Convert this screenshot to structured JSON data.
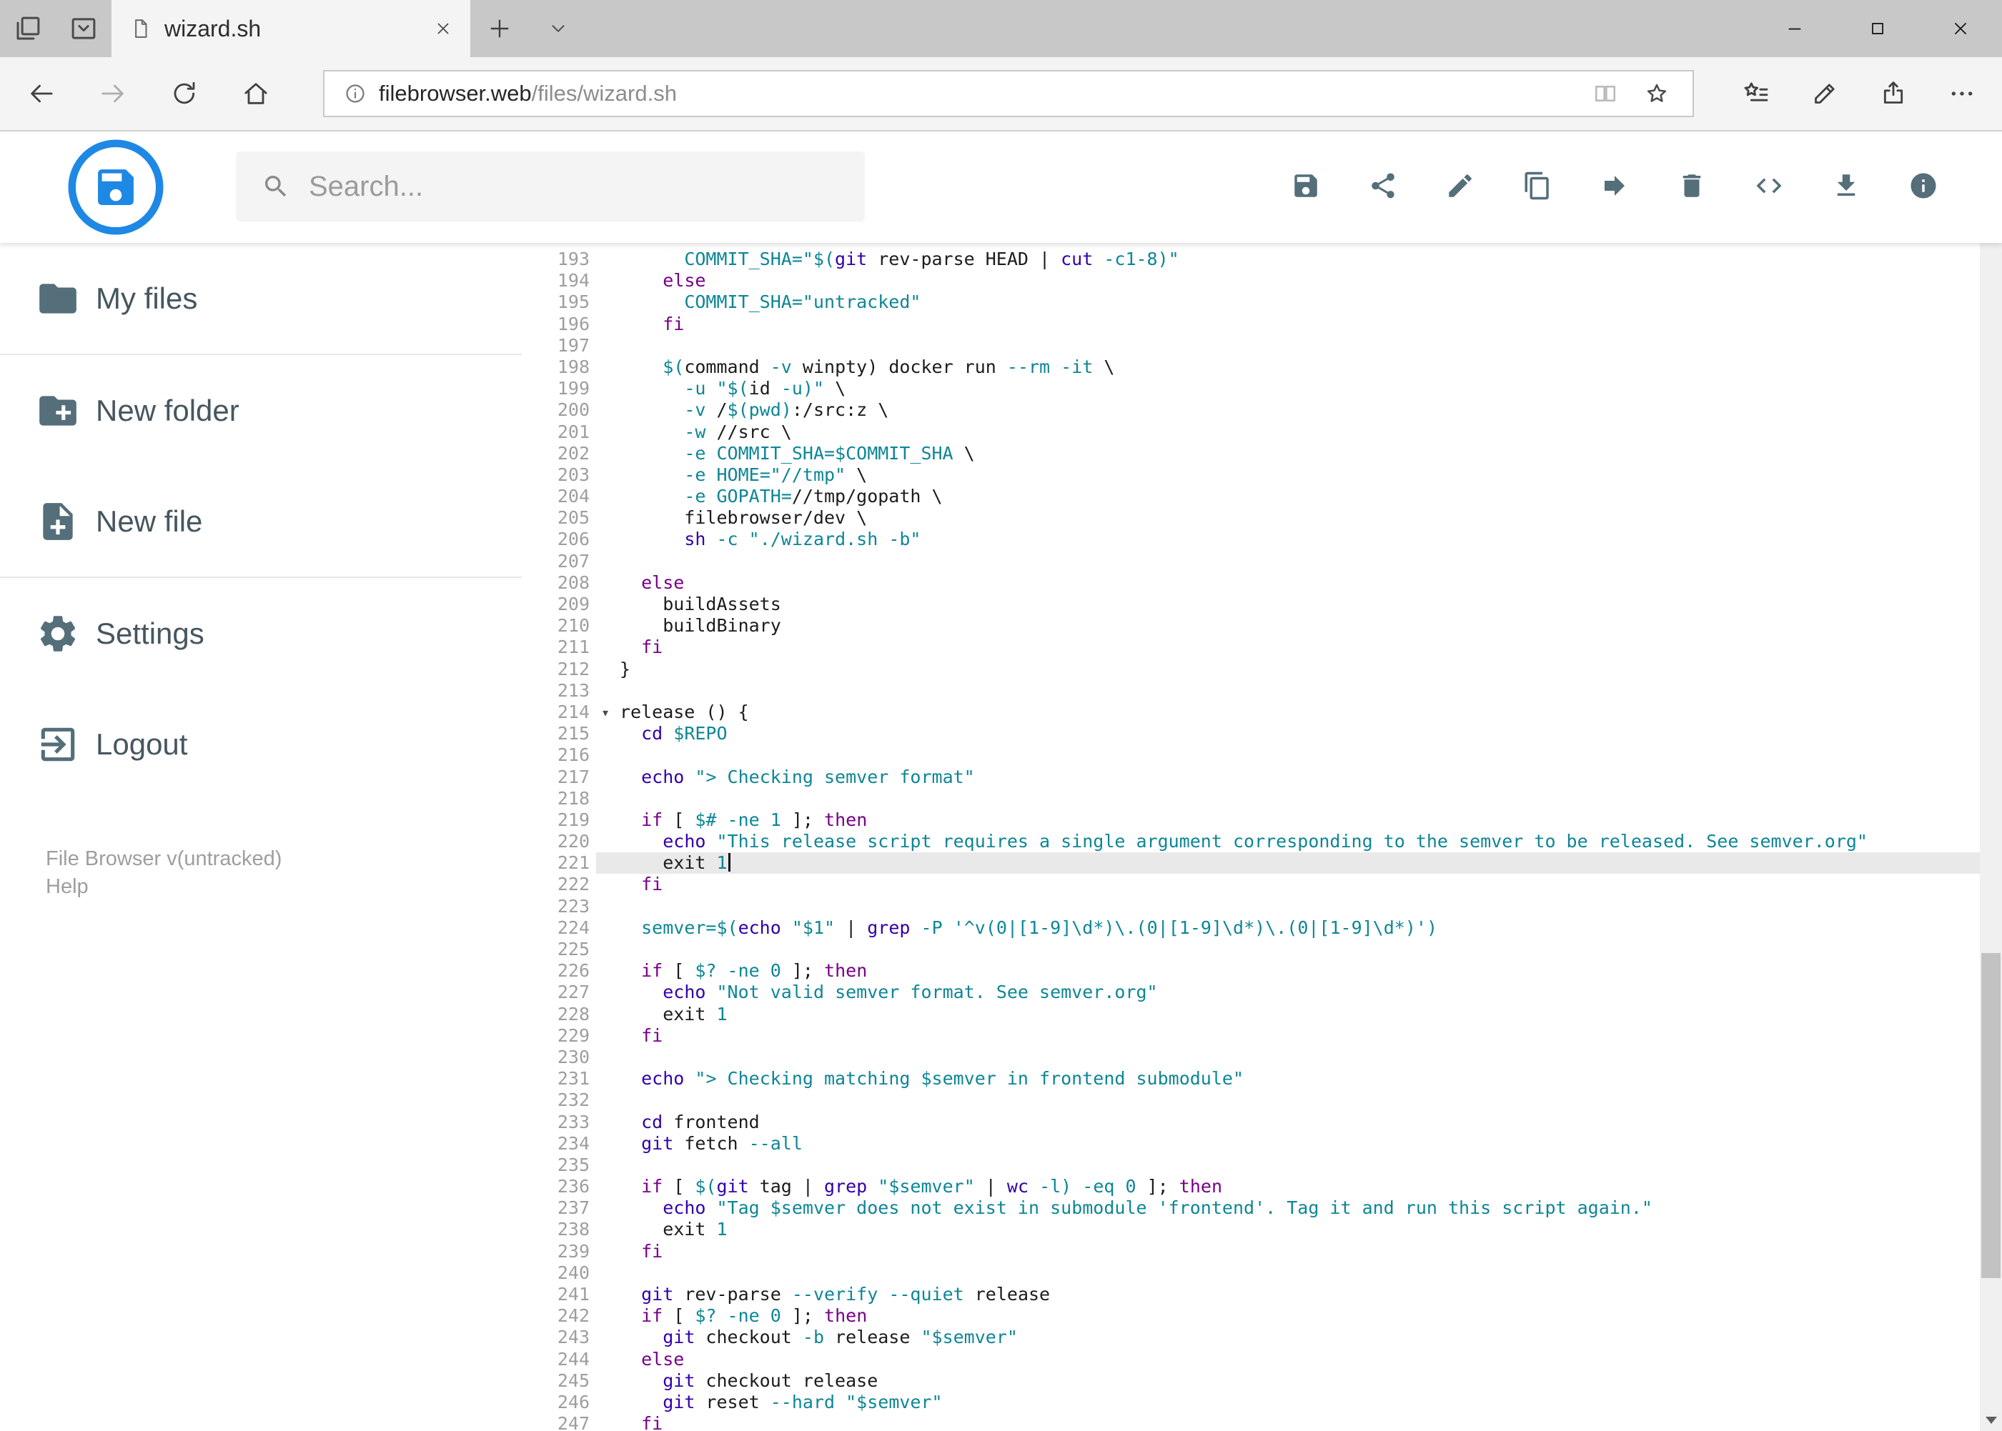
{
  "browser": {
    "tab_title": "wizard.sh",
    "url_domain": "filebrowser.web",
    "url_path": "/files/wizard.sh"
  },
  "header": {
    "search_placeholder": "Search...",
    "actions": [
      {
        "id": "save",
        "icon": "save"
      },
      {
        "id": "share",
        "icon": "share"
      },
      {
        "id": "edit",
        "icon": "edit"
      },
      {
        "id": "copy",
        "icon": "copy"
      },
      {
        "id": "move",
        "icon": "move"
      },
      {
        "id": "delete",
        "icon": "delete"
      },
      {
        "id": "raw-code",
        "icon": "code"
      },
      {
        "id": "download",
        "icon": "download"
      },
      {
        "id": "info",
        "icon": "info"
      }
    ]
  },
  "sidebar": {
    "items": [
      {
        "id": "my-files",
        "label": "My files",
        "icon": "folder",
        "divider_after": true
      },
      {
        "id": "new-folder",
        "label": "New folder",
        "icon": "folder-plus"
      },
      {
        "id": "new-file",
        "label": "New file",
        "icon": "file-plus",
        "divider_after": true
      },
      {
        "id": "settings",
        "label": "Settings",
        "icon": "gear"
      },
      {
        "id": "logout",
        "label": "Logout",
        "icon": "logout"
      }
    ],
    "footer_version": "File Browser v(untracked)",
    "footer_help": "Help"
  },
  "editor": {
    "active_line": 221,
    "cursor_line": 221,
    "fold_lines": [
      214
    ],
    "lines": [
      {
        "n": 193,
        "s": [
          [
            "d",
            "      "
          ],
          [
            "t",
            "COMMIT_SHA=\"$("
          ],
          [
            "b",
            "git"
          ],
          [
            "d",
            " rev-parse HEAD | "
          ],
          [
            "b",
            "cut"
          ],
          [
            "d",
            " "
          ],
          [
            "t",
            "-c1-8)\""
          ]
        ]
      },
      {
        "n": 194,
        "s": [
          [
            "d",
            "    "
          ],
          [
            "k",
            "else"
          ]
        ]
      },
      {
        "n": 195,
        "s": [
          [
            "d",
            "      "
          ],
          [
            "t",
            "COMMIT_SHA=\"untracked\""
          ]
        ]
      },
      {
        "n": 196,
        "s": [
          [
            "d",
            "    "
          ],
          [
            "k",
            "fi"
          ]
        ]
      },
      {
        "n": 197,
        "s": []
      },
      {
        "n": 198,
        "s": [
          [
            "d",
            "    "
          ],
          [
            "t",
            "$("
          ],
          [
            "d",
            "command "
          ],
          [
            "t",
            "-v"
          ],
          [
            "d",
            " winpty) docker run "
          ],
          [
            "t",
            "--rm"
          ],
          [
            "d",
            " "
          ],
          [
            "t",
            "-it"
          ],
          [
            "d",
            " \\"
          ]
        ]
      },
      {
        "n": 199,
        "s": [
          [
            "d",
            "      "
          ],
          [
            "t",
            "-u"
          ],
          [
            "d",
            " "
          ],
          [
            "t",
            "\"$("
          ],
          [
            "d",
            "id "
          ],
          [
            "t",
            "-u)\""
          ],
          [
            "d",
            " \\"
          ]
        ]
      },
      {
        "n": 200,
        "s": [
          [
            "d",
            "      "
          ],
          [
            "t",
            "-v"
          ],
          [
            "d",
            " /"
          ],
          [
            "t",
            "$(pwd)"
          ],
          [
            "d",
            ":/src:z \\"
          ]
        ]
      },
      {
        "n": 201,
        "s": [
          [
            "d",
            "      "
          ],
          [
            "t",
            "-w"
          ],
          [
            "d",
            " //src \\"
          ]
        ]
      },
      {
        "n": 202,
        "s": [
          [
            "d",
            "      "
          ],
          [
            "t",
            "-e"
          ],
          [
            "d",
            " "
          ],
          [
            "t",
            "COMMIT_SHA=$COMMIT_SHA"
          ],
          [
            "d",
            " \\"
          ]
        ]
      },
      {
        "n": 203,
        "s": [
          [
            "d",
            "      "
          ],
          [
            "t",
            "-e"
          ],
          [
            "d",
            " "
          ],
          [
            "t",
            "HOME=\"//tmp\""
          ],
          [
            "d",
            " \\"
          ]
        ]
      },
      {
        "n": 204,
        "s": [
          [
            "d",
            "      "
          ],
          [
            "t",
            "-e"
          ],
          [
            "d",
            " "
          ],
          [
            "t",
            "GOPATH="
          ],
          [
            "d",
            "//tmp/gopath \\"
          ]
        ]
      },
      {
        "n": 205,
        "s": [
          [
            "d",
            "      filebrowser/dev \\"
          ]
        ]
      },
      {
        "n": 206,
        "s": [
          [
            "d",
            "      "
          ],
          [
            "b",
            "sh"
          ],
          [
            "d",
            " "
          ],
          [
            "t",
            "-c"
          ],
          [
            "d",
            " "
          ],
          [
            "t",
            "\"./wizard.sh -b\""
          ]
        ]
      },
      {
        "n": 207,
        "s": []
      },
      {
        "n": 208,
        "s": [
          [
            "d",
            "  "
          ],
          [
            "k",
            "else"
          ]
        ]
      },
      {
        "n": 209,
        "s": [
          [
            "d",
            "    buildAssets"
          ]
        ]
      },
      {
        "n": 210,
        "s": [
          [
            "d",
            "    buildBinary"
          ]
        ]
      },
      {
        "n": 211,
        "s": [
          [
            "d",
            "  "
          ],
          [
            "k",
            "fi"
          ]
        ]
      },
      {
        "n": 212,
        "s": [
          [
            "d",
            "}"
          ]
        ]
      },
      {
        "n": 213,
        "s": []
      },
      {
        "n": 214,
        "s": [
          [
            "d",
            "release () {"
          ]
        ]
      },
      {
        "n": 215,
        "s": [
          [
            "d",
            "  "
          ],
          [
            "b",
            "cd"
          ],
          [
            "d",
            " "
          ],
          [
            "t",
            "$REPO"
          ]
        ]
      },
      {
        "n": 216,
        "s": []
      },
      {
        "n": 217,
        "s": [
          [
            "d",
            "  "
          ],
          [
            "b",
            "echo"
          ],
          [
            "d",
            " "
          ],
          [
            "t",
            "\"> Checking semver format\""
          ]
        ]
      },
      {
        "n": 218,
        "s": []
      },
      {
        "n": 219,
        "s": [
          [
            "d",
            "  "
          ],
          [
            "k",
            "if"
          ],
          [
            "d",
            " [ "
          ],
          [
            "t",
            "$#"
          ],
          [
            "d",
            " "
          ],
          [
            "t",
            "-ne"
          ],
          [
            "d",
            " "
          ],
          [
            "t",
            "1"
          ],
          [
            "d",
            " ]; "
          ],
          [
            "k",
            "then"
          ]
        ]
      },
      {
        "n": 220,
        "s": [
          [
            "d",
            "    "
          ],
          [
            "b",
            "echo"
          ],
          [
            "d",
            " "
          ],
          [
            "t",
            "\"This release script requires a single argument corresponding to the semver to be released. See semver.org\""
          ]
        ]
      },
      {
        "n": 221,
        "s": [
          [
            "d",
            "    exit "
          ],
          [
            "t",
            "1"
          ]
        ]
      },
      {
        "n": 222,
        "s": [
          [
            "d",
            "  "
          ],
          [
            "k",
            "fi"
          ]
        ]
      },
      {
        "n": 223,
        "s": []
      },
      {
        "n": 224,
        "s": [
          [
            "d",
            "  "
          ],
          [
            "t",
            "semver=$("
          ],
          [
            "b",
            "echo"
          ],
          [
            "d",
            " "
          ],
          [
            "t",
            "\"$1\""
          ],
          [
            "d",
            " | "
          ],
          [
            "b",
            "grep"
          ],
          [
            "d",
            " "
          ],
          [
            "t",
            "-P"
          ],
          [
            "d",
            " "
          ],
          [
            "t",
            "'^v(0|[1-9]\\d*)\\.(0|[1-9]\\d*)\\.(0|[1-9]\\d*)')"
          ]
        ]
      },
      {
        "n": 225,
        "s": []
      },
      {
        "n": 226,
        "s": [
          [
            "d",
            "  "
          ],
          [
            "k",
            "if"
          ],
          [
            "d",
            " [ "
          ],
          [
            "t",
            "$?"
          ],
          [
            "d",
            " "
          ],
          [
            "t",
            "-ne"
          ],
          [
            "d",
            " "
          ],
          [
            "t",
            "0"
          ],
          [
            "d",
            " ]; "
          ],
          [
            "k",
            "then"
          ]
        ]
      },
      {
        "n": 227,
        "s": [
          [
            "d",
            "    "
          ],
          [
            "b",
            "echo"
          ],
          [
            "d",
            " "
          ],
          [
            "t",
            "\"Not valid semver format. See semver.org\""
          ]
        ]
      },
      {
        "n": 228,
        "s": [
          [
            "d",
            "    exit "
          ],
          [
            "t",
            "1"
          ]
        ]
      },
      {
        "n": 229,
        "s": [
          [
            "d",
            "  "
          ],
          [
            "k",
            "fi"
          ]
        ]
      },
      {
        "n": 230,
        "s": []
      },
      {
        "n": 231,
        "s": [
          [
            "d",
            "  "
          ],
          [
            "b",
            "echo"
          ],
          [
            "d",
            " "
          ],
          [
            "t",
            "\"> Checking matching $semver in frontend submodule\""
          ]
        ]
      },
      {
        "n": 232,
        "s": []
      },
      {
        "n": 233,
        "s": [
          [
            "d",
            "  "
          ],
          [
            "b",
            "cd"
          ],
          [
            "d",
            " frontend"
          ]
        ]
      },
      {
        "n": 234,
        "s": [
          [
            "d",
            "  "
          ],
          [
            "b",
            "git"
          ],
          [
            "d",
            " fetch "
          ],
          [
            "t",
            "--all"
          ]
        ]
      },
      {
        "n": 235,
        "s": []
      },
      {
        "n": 236,
        "s": [
          [
            "d",
            "  "
          ],
          [
            "k",
            "if"
          ],
          [
            "d",
            " [ "
          ],
          [
            "t",
            "$("
          ],
          [
            "b",
            "git"
          ],
          [
            "d",
            " tag | "
          ],
          [
            "b",
            "grep"
          ],
          [
            "d",
            " "
          ],
          [
            "t",
            "\"$semver\""
          ],
          [
            "d",
            " | "
          ],
          [
            "b",
            "wc"
          ],
          [
            "d",
            " "
          ],
          [
            "t",
            "-l)"
          ],
          [
            "d",
            " "
          ],
          [
            "t",
            "-eq"
          ],
          [
            "d",
            " "
          ],
          [
            "t",
            "0"
          ],
          [
            "d",
            " ]; "
          ],
          [
            "k",
            "then"
          ]
        ]
      },
      {
        "n": 237,
        "s": [
          [
            "d",
            "    "
          ],
          [
            "b",
            "echo"
          ],
          [
            "d",
            " "
          ],
          [
            "t",
            "\"Tag $semver does not exist in submodule 'frontend'. Tag it and run this script again.\""
          ]
        ]
      },
      {
        "n": 238,
        "s": [
          [
            "d",
            "    exit "
          ],
          [
            "t",
            "1"
          ]
        ]
      },
      {
        "n": 239,
        "s": [
          [
            "d",
            "  "
          ],
          [
            "k",
            "fi"
          ]
        ]
      },
      {
        "n": 240,
        "s": []
      },
      {
        "n": 241,
        "s": [
          [
            "d",
            "  "
          ],
          [
            "b",
            "git"
          ],
          [
            "d",
            " rev-parse "
          ],
          [
            "t",
            "--verify"
          ],
          [
            "d",
            " "
          ],
          [
            "t",
            "--quiet"
          ],
          [
            "d",
            " release"
          ]
        ]
      },
      {
        "n": 242,
        "s": [
          [
            "d",
            "  "
          ],
          [
            "k",
            "if"
          ],
          [
            "d",
            " [ "
          ],
          [
            "t",
            "$?"
          ],
          [
            "d",
            " "
          ],
          [
            "t",
            "-ne"
          ],
          [
            "d",
            " "
          ],
          [
            "t",
            "0"
          ],
          [
            "d",
            " ]; "
          ],
          [
            "k",
            "then"
          ]
        ]
      },
      {
        "n": 243,
        "s": [
          [
            "d",
            "    "
          ],
          [
            "b",
            "git"
          ],
          [
            "d",
            " checkout "
          ],
          [
            "t",
            "-b"
          ],
          [
            "d",
            " release "
          ],
          [
            "t",
            "\"$semver\""
          ]
        ]
      },
      {
        "n": 244,
        "s": [
          [
            "d",
            "  "
          ],
          [
            "k",
            "else"
          ]
        ]
      },
      {
        "n": 245,
        "s": [
          [
            "d",
            "    "
          ],
          [
            "b",
            "git"
          ],
          [
            "d",
            " checkout release"
          ]
        ]
      },
      {
        "n": 246,
        "s": [
          [
            "d",
            "    "
          ],
          [
            "b",
            "git"
          ],
          [
            "d",
            " reset "
          ],
          [
            "t",
            "--hard"
          ],
          [
            "d",
            " "
          ],
          [
            "t",
            "\"$semver\""
          ]
        ]
      },
      {
        "n": 247,
        "s": [
          [
            "d",
            "  "
          ],
          [
            "k",
            "fi"
          ]
        ]
      }
    ]
  },
  "colors": {
    "accent_blue": "#1e88e5",
    "icon_gray": "#546e7a",
    "token_keyword": "#770088",
    "token_builtin": "#3300aa",
    "token_value": "#0e8695",
    "token_text": "#1c1c1c",
    "gutter_number": "#9e9e9e",
    "active_line_bg": "#e9e9e9"
  }
}
